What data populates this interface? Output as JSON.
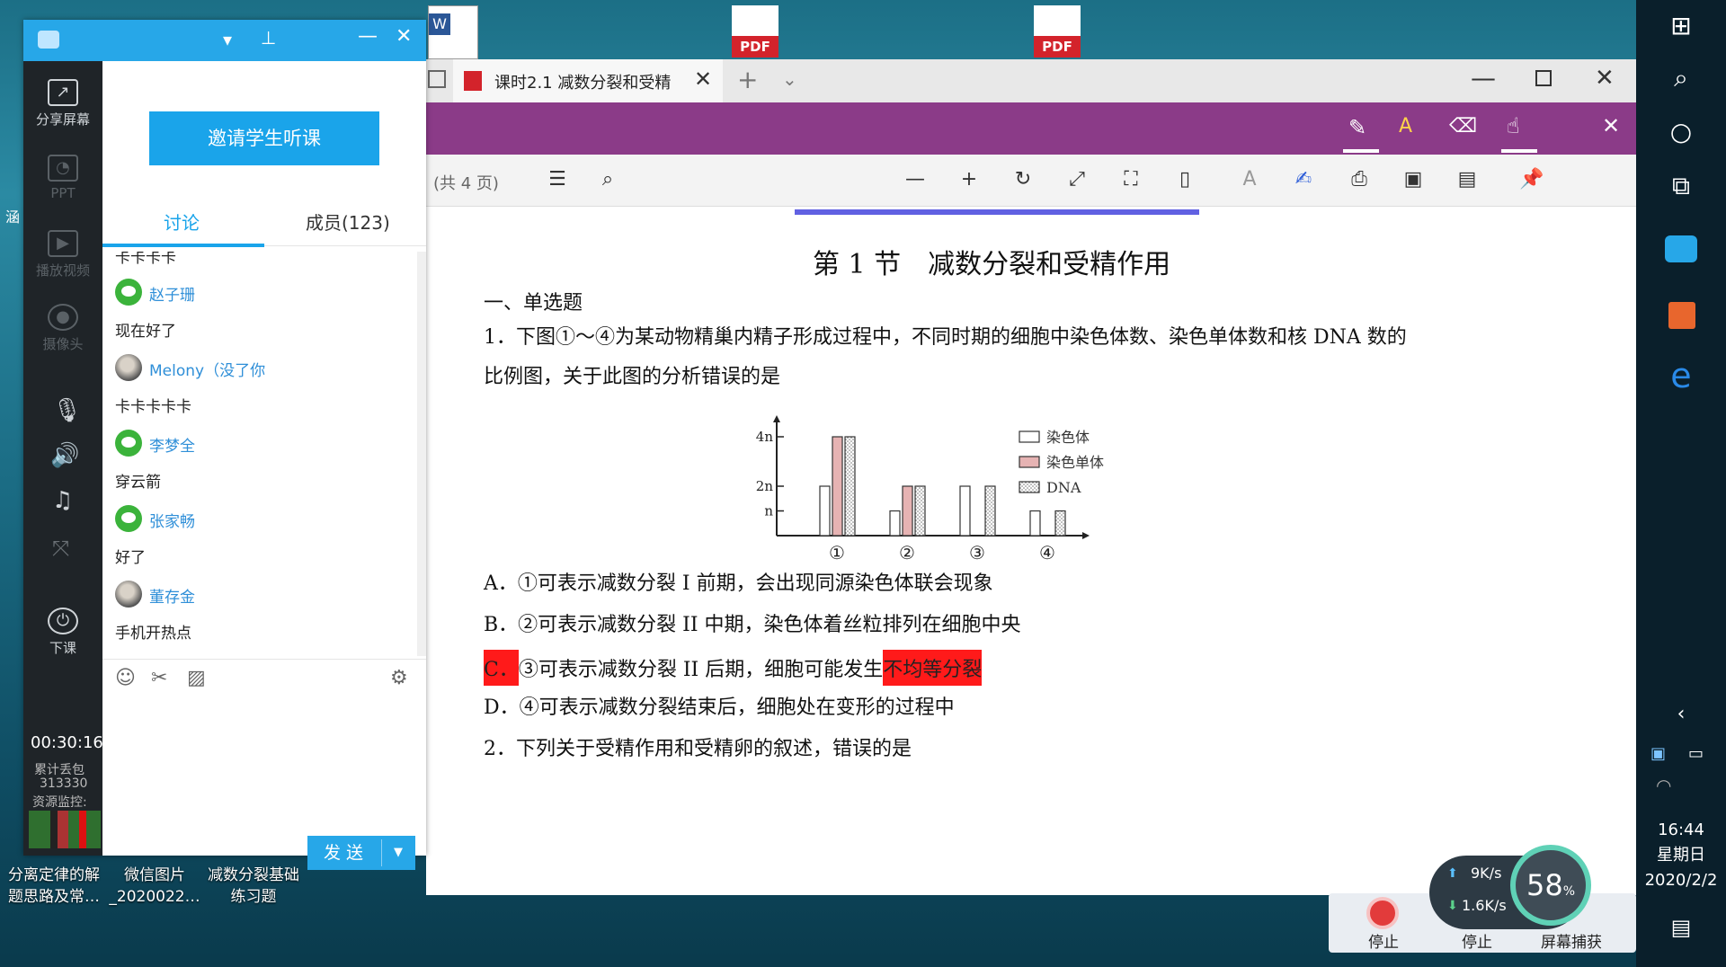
{
  "desktop": {
    "icons": [
      {
        "label": "分离定律的解\n题思路及常…"
      },
      {
        "label": "微信图片\n_2020022…"
      },
      {
        "label": "减数分裂基础\n练习题"
      }
    ],
    "left_edge_labels": [
      "涵"
    ],
    "pdf_tag": "PDF"
  },
  "share_strip": {
    "items": [
      {
        "label": "分享屏幕"
      },
      {
        "label": "PPT"
      },
      {
        "label": "播放视频"
      },
      {
        "label": "摄像头"
      },
      {
        "label": "下课"
      }
    ],
    "timer": "00:30:16",
    "lost_label": "累计丢包",
    "lost_count": "313330",
    "monitor_label": "资源监控:"
  },
  "discussion": {
    "invite_button": "邀请学生听课",
    "tab_discussion": "讨论",
    "tab_members": "成员(123)",
    "messages": [
      {
        "name": "",
        "text": "卡卡卡卡"
      },
      {
        "name": "赵子珊",
        "text": "现在好了"
      },
      {
        "name": "Melony（没了你",
        "text": "卡卡卡卡卡"
      },
      {
        "name": "李梦全",
        "text": "穿云箭"
      },
      {
        "name": "张家畅",
        "text": "好了"
      },
      {
        "name": "董存金",
        "text": "手机开热点"
      }
    ],
    "send_button": "发 送"
  },
  "pdf": {
    "tab_title": "课时2.1 减数分裂和受精",
    "page_count": "(共 4 页)",
    "page": {
      "section_title": "第 1 节　减数分裂和受精作用",
      "section_heading": "一、单选题",
      "q1_line1": "1．下图①～④为某动物精巢内精子形成过程中，不同时期的细胞中染色体数、染色单体数和核 DNA 数的",
      "q1_line2": "比例图，关于此图的分析错误的是",
      "option_a": "A．①可表示减数分裂 I 前期，会出现同源染色体联会现象",
      "option_b": "B．②可表示减数分裂 II 中期，染色体着丝粒排列在细胞中央",
      "option_c_letter": "C．",
      "option_c_mid": "③可表示减数分裂 II 后期，细胞可能发生",
      "option_c_hl": "不均等分裂",
      "option_d": "D．④可表示减数分裂结束后，细胞处在变形的过程中",
      "q2": "2．下列关于受精作用和受精卵的叙述，错误的是"
    }
  },
  "chart_data": {
    "type": "bar",
    "categories": [
      "①",
      "②",
      "③",
      "④"
    ],
    "y_ticks": [
      "n",
      "2n",
      "4n"
    ],
    "y_tick_values": [
      1,
      2,
      4
    ],
    "series": [
      {
        "name": "染色体",
        "values": [
          2,
          1,
          2,
          1
        ]
      },
      {
        "name": "染色单体",
        "values": [
          4,
          2,
          0,
          0
        ]
      },
      {
        "name": "DNA",
        "values": [
          4,
          2,
          2,
          1
        ]
      }
    ],
    "ylim": [
      0,
      5
    ],
    "legend": "right"
  },
  "widgets": {
    "upload_speed": "9K/s",
    "download_speed": "1.6K/s",
    "percent": "58",
    "stop1": "停止",
    "stop2": "停止",
    "capture": "屏幕捕获"
  },
  "taskbar": {
    "time": "16:44",
    "weekday": "星期日",
    "date": "2020/2/2"
  },
  "colors": {
    "qq_blue": "#27a7e8",
    "pdf_purple": "#8b3b88",
    "highlight_red": "#ff1a1a"
  }
}
